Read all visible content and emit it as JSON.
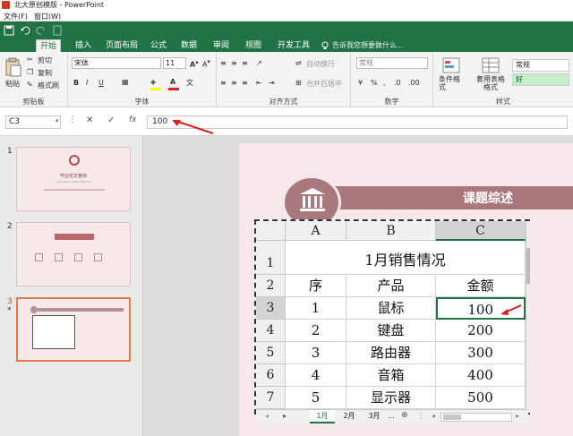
{
  "app": {
    "title": "北大原创模版 - PowerPoint",
    "menu": [
      "文件(F)",
      "窗口(W)"
    ]
  },
  "ribbon_tabs": [
    "开始",
    "插入",
    "页面布局",
    "公式",
    "数据",
    "审阅",
    "视图",
    "开发工具"
  ],
  "active_tab": "开始",
  "tell_me": "告诉我您想要做什么...",
  "clipboard": {
    "paste": "粘贴",
    "cut": "剪切",
    "copy": "复制",
    "format_painter": "格式刷",
    "label": "剪贴板"
  },
  "font": {
    "name": "宋体",
    "size": "11",
    "bold": "B",
    "italic": "I",
    "underline": "U",
    "label": "字体"
  },
  "alignment": {
    "wrap": "自动换行",
    "merge": "合并后居中",
    "label": "对齐方式"
  },
  "number": {
    "format": "常规",
    "label": "数字"
  },
  "styles": {
    "conditional": "条件格式",
    "table": "套用表格格式",
    "normal": "常规",
    "good": "好",
    "label": "样式"
  },
  "formula_bar": {
    "name_box": "C3",
    "cancel": "✕",
    "enter": "✓",
    "fx": "fx",
    "value": "100"
  },
  "slides": [
    {
      "num": "1",
      "title": "毕业论文答辩",
      "subtitle": "graduation thesis defense"
    },
    {
      "num": "2"
    },
    {
      "num": "3",
      "star": "*"
    }
  ],
  "slide": {
    "header": "课题综述"
  },
  "sheet": {
    "columns": [
      "A",
      "B",
      "C"
    ],
    "rows": [
      "1",
      "2",
      "3",
      "4",
      "5",
      "6",
      "7"
    ],
    "title": "1月销售情况",
    "headers": [
      "序",
      "产品",
      "金额"
    ],
    "data": [
      [
        "1",
        "鼠标",
        "100"
      ],
      [
        "2",
        "键盘",
        "200"
      ],
      [
        "3",
        "路由器",
        "300"
      ],
      [
        "4",
        "音箱",
        "400"
      ],
      [
        "5",
        "显示器",
        "500"
      ]
    ],
    "tabs": [
      "1月",
      "2月",
      "3月",
      "..."
    ],
    "active_tab": "1月"
  },
  "colors": {
    "accent": "#217346",
    "slide_header": "#a8787b",
    "arrow": "#d42020"
  }
}
